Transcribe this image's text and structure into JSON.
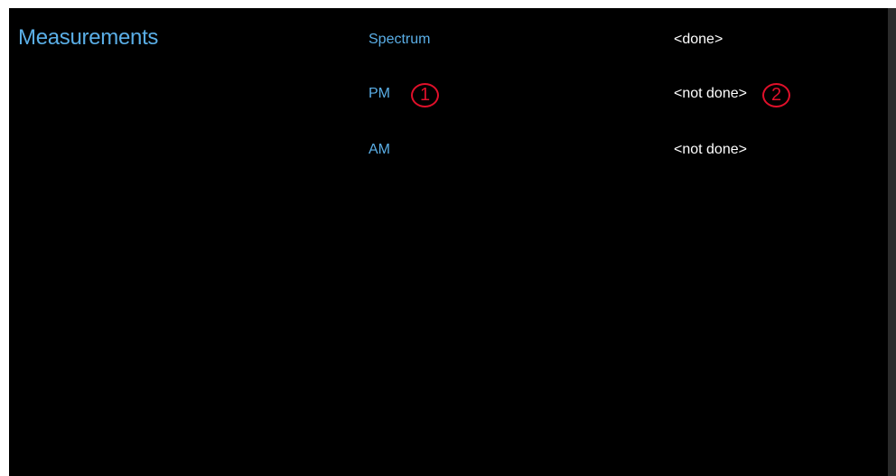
{
  "header": {
    "title": "Measurements"
  },
  "measurements": [
    {
      "name": "Spectrum",
      "status": "<done>"
    },
    {
      "name": "PM",
      "status": "<not done>"
    },
    {
      "name": "AM",
      "status": "<not done>"
    }
  ],
  "callouts": {
    "one": "1",
    "two": "2"
  },
  "colors": {
    "background": "#000000",
    "accent": "#5aaee6",
    "status_text": "#ffffff",
    "callout": "#e0102a"
  }
}
